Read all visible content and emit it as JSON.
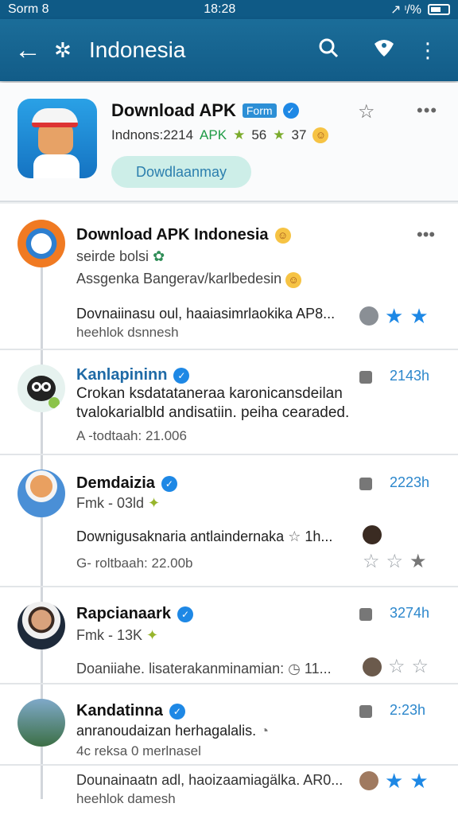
{
  "status_bar": {
    "carrier": "Sorm 8",
    "time": "18:28",
    "signal": "↗ ᶦ/%"
  },
  "app_bar": {
    "back_icon": "arrow-left-icon",
    "title": "Indonesia"
  },
  "hero": {
    "title": "Download APK",
    "badge": "Form",
    "sub_name": "Indnons:2214",
    "apk": "APK",
    "count": "56",
    "rating": "37",
    "button": "Dowdlaanmay"
  },
  "feed": {
    "post1": {
      "title": "Download APK Indonesia",
      "subtitle": "seirde bolsi",
      "line2": "Assgenka Bangerav/karlbedesin",
      "line3": "Dovnaiinasu oul, haaiasimrlaokika AP8...",
      "line4": "heehlok dsnnesh"
    },
    "post2": {
      "title": "Kanlapininn",
      "time": "2143h",
      "line1": "Crokan ksdatataneraa karonicansdeilan",
      "line2": "tvalokarialbld andisatiin. peiha cearaded.",
      "meta": "A -todtaah: 21.006"
    },
    "post3": {
      "title": "Demdaizia",
      "time": "2223h",
      "subtitle": "Fmk - 03ld",
      "line1": "Downigusaknaria antlaindernaka",
      "line1_tail": "1h...",
      "meta": "G- roltbaah: 22.00b"
    },
    "post4": {
      "title": "Rapcianaark",
      "time": "3274h",
      "subtitle": "Fmk - 13K",
      "line1": "Doaniiahe. lisaterakanminamian:",
      "line1_tail": "11..."
    },
    "post5": {
      "title": "Kandatinna",
      "time": "2:23h",
      "line1": "anranoudaizan herhagalalis.",
      "meta": "4c reksa 0 merlnasel",
      "footer1": "Dounainaatn adl, haoizaamiagälka. AR0...",
      "footer2": "heehlok damesh"
    }
  }
}
